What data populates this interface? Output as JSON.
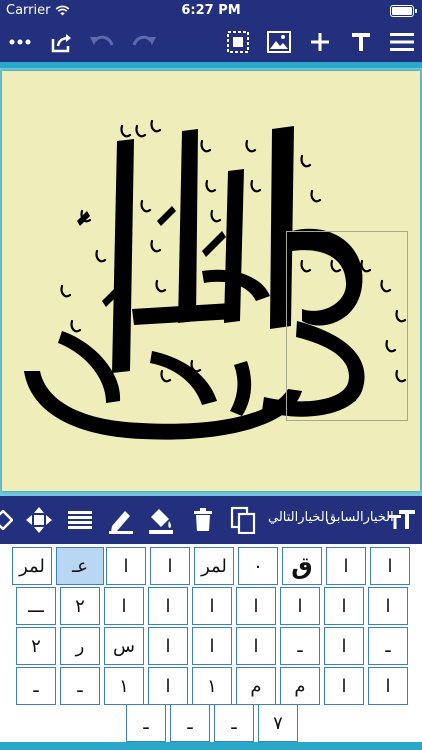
{
  "status": {
    "carrier": "Carrier",
    "time": "6:27 PM"
  },
  "toolbar": {
    "more": "more-icon",
    "share": "share-icon",
    "undo": "undo-icon",
    "redo": "redo-icon",
    "select": "select-icon",
    "image": "image-icon",
    "add": "add-icon",
    "text": "text-icon",
    "menu": "menu-icon"
  },
  "editbar": {
    "next_label": "الخيارالتالي",
    "prev_label": "الخيارالسابق"
  },
  "glyphs": {
    "row1": [
      "لمر",
      "عـ",
      "ا",
      "ا",
      "لمر",
      "٠",
      "ق",
      "ا",
      "ا"
    ],
    "row2": [
      "ـــ",
      "٢",
      "ا",
      "ا",
      "ا",
      "ا",
      "ا",
      "ا",
      "ا"
    ],
    "row3": [
      "٢",
      "ر",
      "س",
      "ا",
      "ا",
      "ا",
      "ـ",
      "ا",
      "ـ"
    ],
    "row4": [
      "ـ",
      "ـ",
      "١",
      "ا",
      "١",
      "م",
      "م",
      "ا",
      "ا"
    ],
    "row5": [
      "ـ",
      "ـ",
      "ـ",
      "٧"
    ]
  },
  "colors": {
    "toolbar": "#23307e",
    "accent": "#2aa8c9",
    "paper": "#efedb9",
    "cell_border": "#3b7fc4"
  }
}
